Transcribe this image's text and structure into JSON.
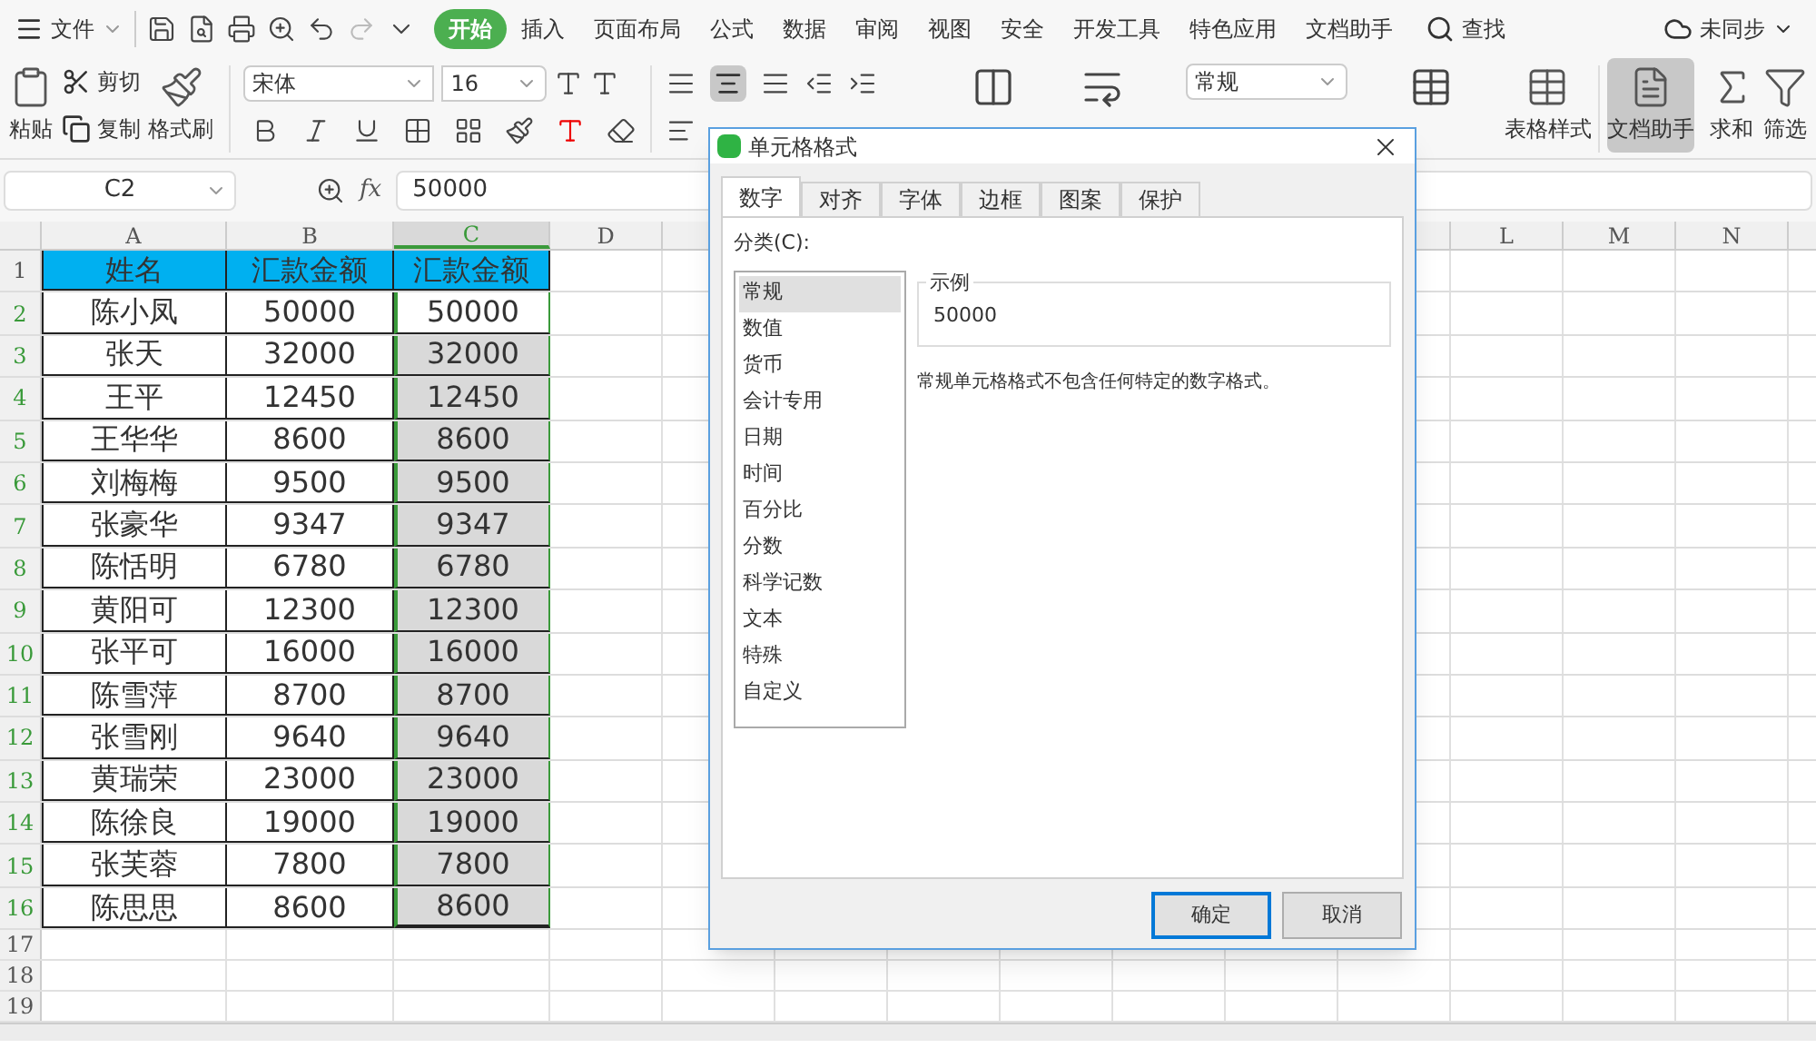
{
  "menu": {
    "file": "文件",
    "tabs": [
      {
        "label": "开始",
        "selected": true
      },
      {
        "label": "插入",
        "selected": false
      },
      {
        "label": "页面布局",
        "selected": false
      },
      {
        "label": "公式",
        "selected": false
      },
      {
        "label": "数据",
        "selected": false
      },
      {
        "label": "审阅",
        "selected": false
      },
      {
        "label": "视图",
        "selected": false
      },
      {
        "label": "安全",
        "selected": false
      },
      {
        "label": "开发工具",
        "selected": false
      },
      {
        "label": "特色应用",
        "selected": false
      },
      {
        "label": "文档助手",
        "selected": false
      }
    ],
    "search": "查找",
    "sync": "未同步"
  },
  "ribbon": {
    "paste": "粘贴",
    "cut": "剪切",
    "copy": "复制",
    "format_painter": "格式刷",
    "font": "宋体",
    "font_size": "16",
    "number_format": "常规",
    "table_style": "表格样式",
    "doc_helper": "文档助手",
    "sum": "求和",
    "filter": "筛选"
  },
  "formula_bar": {
    "cell_ref": "C2",
    "fx": "fx",
    "value": "50000"
  },
  "sheet": {
    "columns": [
      {
        "label": "A",
        "selected": false
      },
      {
        "label": "B",
        "selected": false
      },
      {
        "label": "C",
        "selected": true
      },
      {
        "label": "D",
        "selected": false
      }
    ],
    "right_columns": [
      {
        "label": "L"
      },
      {
        "label": "M"
      },
      {
        "label": "N"
      }
    ],
    "rows": [
      {
        "number": "1",
        "selected": false,
        "cells": [
          "姓名",
          "汇款金额",
          "汇款金额"
        ]
      },
      {
        "number": "2",
        "selected": true,
        "cells": [
          "陈小凤",
          "50000",
          "50000"
        ]
      },
      {
        "number": "3",
        "selected": true,
        "cells": [
          "张天",
          "32000",
          "32000"
        ]
      },
      {
        "number": "4",
        "selected": true,
        "cells": [
          "王平",
          "12450",
          "12450"
        ]
      },
      {
        "number": "5",
        "selected": true,
        "cells": [
          "王华华",
          "8600",
          "8600"
        ]
      },
      {
        "number": "6",
        "selected": true,
        "cells": [
          "刘梅梅",
          "9500",
          "9500"
        ]
      },
      {
        "number": "7",
        "selected": true,
        "cells": [
          "张豪华",
          "9347",
          "9347"
        ]
      },
      {
        "number": "8",
        "selected": true,
        "cells": [
          "陈恬明",
          "6780",
          "6780"
        ]
      },
      {
        "number": "9",
        "selected": true,
        "cells": [
          "黄阳可",
          "12300",
          "12300"
        ]
      },
      {
        "number": "10",
        "selected": true,
        "cells": [
          "张平可",
          "16000",
          "16000"
        ]
      },
      {
        "number": "11",
        "selected": true,
        "cells": [
          "陈雪萍",
          "8700",
          "8700"
        ]
      },
      {
        "number": "12",
        "selected": true,
        "cells": [
          "张雪刚",
          "9640",
          "9640"
        ]
      },
      {
        "number": "13",
        "selected": true,
        "cells": [
          "黄瑞荣",
          "23000",
          "23000"
        ]
      },
      {
        "number": "14",
        "selected": true,
        "cells": [
          "陈徐良",
          "19000",
          "19000"
        ]
      },
      {
        "number": "15",
        "selected": true,
        "cells": [
          "张芙蓉",
          "7800",
          "7800"
        ]
      },
      {
        "number": "16",
        "selected": true,
        "cells": [
          "陈思思",
          "8600",
          "8600"
        ]
      }
    ],
    "empty_rows": [
      "17",
      "18",
      "19"
    ]
  },
  "dialog": {
    "title": "单元格格式",
    "tabs": [
      {
        "label": "数字",
        "selected": true
      },
      {
        "label": "对齐",
        "selected": false
      },
      {
        "label": "字体",
        "selected": false
      },
      {
        "label": "边框",
        "selected": false
      },
      {
        "label": "图案",
        "selected": false
      },
      {
        "label": "保护",
        "selected": false
      }
    ],
    "category_label": "分类(C):",
    "categories": [
      {
        "label": "常规",
        "selected": true
      },
      {
        "label": "数值",
        "selected": false
      },
      {
        "label": "货币",
        "selected": false
      },
      {
        "label": "会计专用",
        "selected": false
      },
      {
        "label": "日期",
        "selected": false
      },
      {
        "label": "时间",
        "selected": false
      },
      {
        "label": "百分比",
        "selected": false
      },
      {
        "label": "分数",
        "selected": false
      },
      {
        "label": "科学记数",
        "selected": false
      },
      {
        "label": "文本",
        "selected": false
      },
      {
        "label": "特殊",
        "selected": false
      },
      {
        "label": "自定义",
        "selected": false
      }
    ],
    "sample_label": "示例",
    "sample_value": "50000",
    "description": "常规单元格格式不包含任何特定的数字格式。",
    "ok": "确定",
    "cancel": "取消"
  }
}
